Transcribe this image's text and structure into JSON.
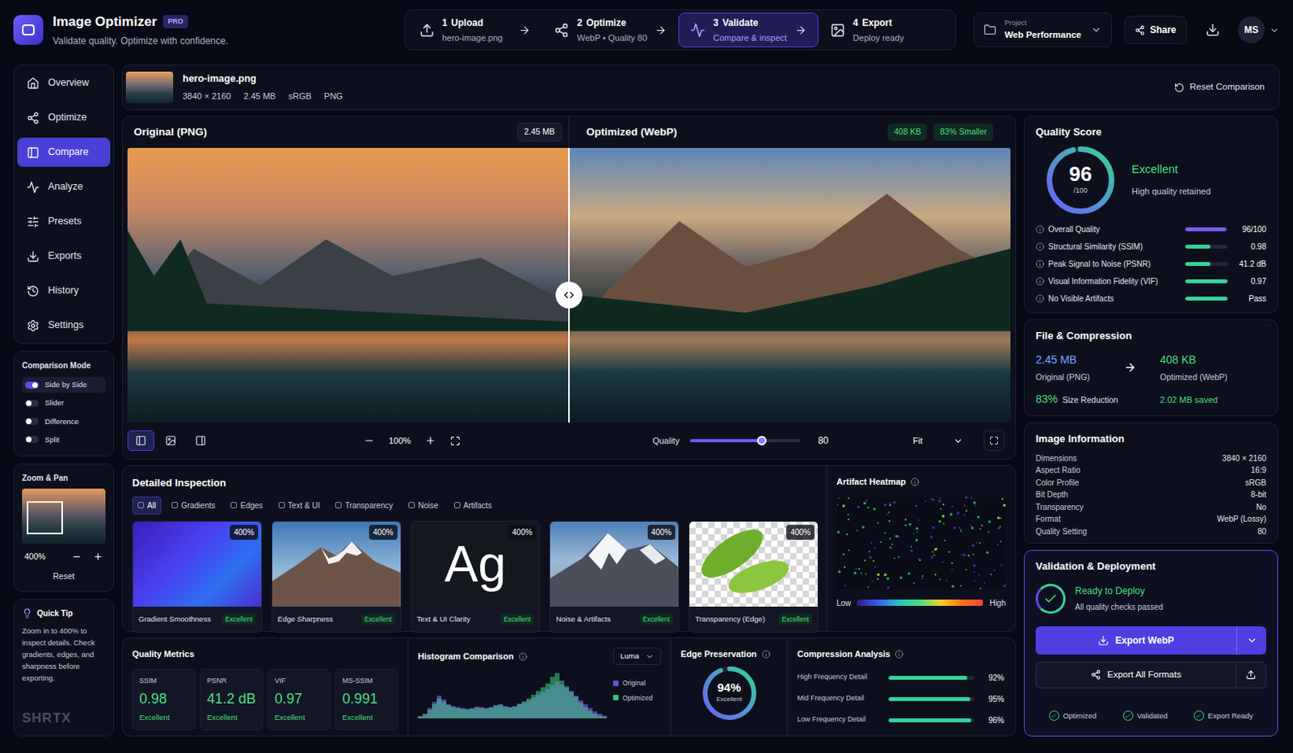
{
  "app": {
    "title": "Image Optimizer",
    "badge": "PRO",
    "subtitle": "Validate quality. Optimize with confidence."
  },
  "steps": [
    {
      "number": "1",
      "label": "Upload",
      "detail": "hero-image.png",
      "selected": false
    },
    {
      "number": "2",
      "label": "Optimize",
      "detail": "WebP • Quality 80",
      "selected": false
    },
    {
      "number": "3",
      "label": "Validate",
      "detail": "Compare & inspect",
      "selected": true
    },
    {
      "number": "4",
      "label": "Export",
      "detail": "Deploy ready",
      "selected": false
    }
  ],
  "project": {
    "label": "Project",
    "value": "Web Performance"
  },
  "share": "Share",
  "avatar": "MS",
  "sidebar": {
    "items": [
      {
        "label": "Overview",
        "selected": false
      },
      {
        "label": "Optimize",
        "selected": false
      },
      {
        "label": "Compare",
        "selected": true
      },
      {
        "label": "Analyze",
        "selected": false
      },
      {
        "label": "Presets",
        "selected": false
      },
      {
        "label": "Exports",
        "selected": false
      },
      {
        "label": "History",
        "selected": false
      },
      {
        "label": "Settings",
        "selected": false
      }
    ]
  },
  "comparison_mode": {
    "title": "Comparison Mode",
    "options": [
      {
        "label": "Side by Side",
        "selected": true
      },
      {
        "label": "Slider",
        "selected": false
      },
      {
        "label": "Difference",
        "selected": false
      },
      {
        "label": "Split",
        "selected": false
      }
    ]
  },
  "zoom_pan": {
    "title": "Zoom & Pan",
    "zoom": "400%",
    "reset": "Reset"
  },
  "quick_tip": {
    "title": "Quick Tip",
    "text": "Zoom in to 400% to inspect details. Check gradients, edges, and sharpness before exporting."
  },
  "brand": "SHRTX",
  "file": {
    "name": "hero-image.png",
    "meta": [
      "3840 × 2160",
      "2.45 MB",
      "sRGB",
      "PNG"
    ],
    "reset": "Reset Comparison"
  },
  "compare": {
    "original": {
      "title": "Original (PNG)",
      "size": "2.45 MB"
    },
    "optimized": {
      "title": "Optimized (WebP)",
      "size": "408 KB",
      "saving": "83% Smaller"
    },
    "views": [
      {
        "selected": true
      },
      {
        "selected": false
      },
      {
        "selected": false
      }
    ],
    "zoom": "100%",
    "quality": {
      "label": "Quality",
      "value": "80",
      "level": 0.65
    },
    "fit": "Fit"
  },
  "inspection": {
    "title": "Detailed Inspection",
    "tabs": [
      {
        "label": "All",
        "selected": true
      },
      {
        "label": "Gradients",
        "selected": false
      },
      {
        "label": "Edges",
        "selected": false
      },
      {
        "label": "Text & UI",
        "selected": false
      },
      {
        "label": "Transparency",
        "selected": false
      },
      {
        "label": "Noise",
        "selected": false
      },
      {
        "label": "Artifacts",
        "selected": false
      }
    ],
    "cards": [
      {
        "label": "Gradient Smoothness",
        "zoom": "400%",
        "rating": "Excellent",
        "kind": "gradient"
      },
      {
        "label": "Edge Sharpness",
        "zoom": "400%",
        "rating": "Excellent",
        "kind": "mountain"
      },
      {
        "label": "Text & UI Clarity",
        "zoom": "400%",
        "rating": "Excellent",
        "kind": "text",
        "preview": "Ag"
      },
      {
        "label": "Noise & Artifacts",
        "zoom": "400%",
        "rating": "Excellent",
        "kind": "snow"
      },
      {
        "label": "Transparency (Edge)",
        "zoom": "400%",
        "rating": "Excellent",
        "kind": "transparency"
      }
    ]
  },
  "heatmap": {
    "title": "Artifact Heatmap",
    "low": "Low",
    "high": "High"
  },
  "metrics": {
    "title": "Quality Metrics",
    "items": [
      {
        "label": "SSIM",
        "value": "0.98",
        "rating": "Excellent"
      },
      {
        "label": "PSNR",
        "value": "41.2 dB",
        "rating": "Excellent"
      },
      {
        "label": "VIF",
        "value": "0.97",
        "rating": "Excellent"
      },
      {
        "label": "MS-SSIM",
        "value": "0.991",
        "rating": "Excellent"
      }
    ]
  },
  "histogram": {
    "title": "Histogram Comparison",
    "channel": "Luma",
    "series": [
      {
        "name": "Original",
        "color": "#6d4fd8",
        "values": [
          5,
          10,
          22,
          35,
          48,
          40,
          30,
          26,
          24,
          22,
          20,
          22,
          25,
          24,
          22,
          24,
          28,
          30,
          26,
          24,
          26,
          30,
          34,
          38,
          44,
          50,
          56,
          62,
          70,
          78,
          72,
          64,
          56,
          48,
          38,
          30,
          22,
          15,
          10,
          6
        ]
      },
      {
        "name": "Optimized",
        "color": "#3fbf7f",
        "values": [
          4,
          8,
          18,
          30,
          42,
          36,
          28,
          24,
          22,
          20,
          19,
          20,
          23,
          22,
          21,
          23,
          27,
          29,
          25,
          23,
          25,
          31,
          36,
          42,
          50,
          58,
          66,
          74,
          88,
          96,
          80,
          68,
          58,
          46,
          34,
          24,
          16,
          10,
          6,
          3
        ]
      }
    ]
  },
  "edge": {
    "title": "Edge Preservation",
    "value": "94%",
    "rating": "Excellent",
    "level": 0.94
  },
  "compression": {
    "title": "Compression Analysis",
    "rows": [
      {
        "label": "High Frequency Detail",
        "value": "92%",
        "level": 0.92
      },
      {
        "label": "Mid Frequency Detail",
        "value": "95%",
        "level": 0.95
      },
      {
        "label": "Low Frequency Detail",
        "value": "96%",
        "level": 0.96
      }
    ]
  },
  "quality_score": {
    "title": "Quality Score",
    "score": "96",
    "max": "/100",
    "level": 0.96,
    "rating": "Excellent",
    "note": "High quality retained",
    "rows": [
      {
        "label": "Overall Quality",
        "value": "96/100",
        "level": 0.96,
        "color": "#7c5cff"
      },
      {
        "label": "Structural Similarity (SSIM)",
        "value": "0.98",
        "level": 0.6,
        "color": "#34d399"
      },
      {
        "label": "Peak Signal to Noise (PSNR)",
        "value": "41.2 dB",
        "level": 0.6,
        "color": "#34d399"
      },
      {
        "label": "Visual Information Fidelity (VIF)",
        "value": "0.97",
        "level": 1,
        "color": "#34d399"
      },
      {
        "label": "No Visible Artifacts",
        "value": "Pass",
        "level": 1,
        "color": "#34d399"
      }
    ]
  },
  "file_compression": {
    "title": "File & Compression",
    "original": {
      "size": "2.45 MB",
      "label": "Original (PNG)"
    },
    "optimized": {
      "size": "408 KB",
      "label": "Optimized (WebP)"
    },
    "reduction": {
      "value": "83%",
      "label": "Size Reduction"
    },
    "saved": "2.02 MB saved"
  },
  "image_info": {
    "title": "Image Information",
    "rows": [
      {
        "label": "Dimensions",
        "value": "3840 × 2160"
      },
      {
        "label": "Aspect Ratio",
        "value": "16:9"
      },
      {
        "label": "Color Profile",
        "value": "sRGB"
      },
      {
        "label": "Bit Depth",
        "value": "8-bit"
      },
      {
        "label": "Transparency",
        "value": "No"
      },
      {
        "label": "Format",
        "value": "WebP (Lossy)"
      },
      {
        "label": "Quality Setting",
        "value": "80"
      }
    ]
  },
  "validation": {
    "title": "Validation & Deployment",
    "status": "Ready to Deploy",
    "note": "All quality checks passed",
    "primary": "Export WebP",
    "secondary": "Export All Formats",
    "checks": [
      {
        "label": "Optimized",
        "checked": true
      },
      {
        "label": "Validated",
        "checked": true
      },
      {
        "label": "Export Ready",
        "checked": true
      }
    ]
  }
}
